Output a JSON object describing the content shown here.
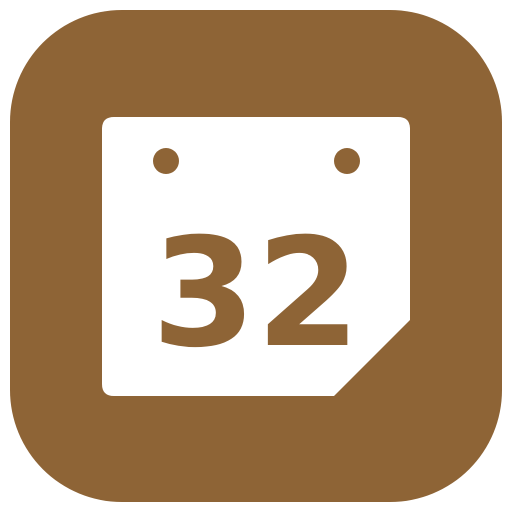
{
  "icon": {
    "name": "calendar-app-icon",
    "background_color": "#8e6436",
    "page_color": "#ffffff"
  },
  "calendar": {
    "day_number": "32",
    "binding_rings": 2,
    "folded_corner": true
  }
}
